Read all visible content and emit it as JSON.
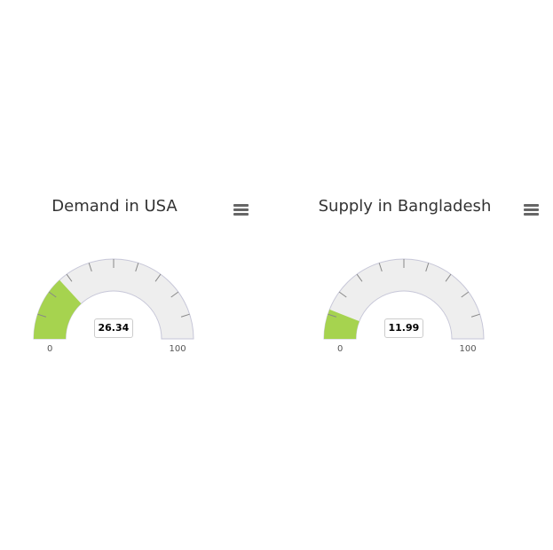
{
  "chart_data": [
    {
      "type": "gauge",
      "title": "Demand in USA",
      "value": 26.34,
      "value_label": "26.34",
      "min": 0,
      "max": 100,
      "min_label": "0",
      "max_label": "100",
      "fill_color": "#a6d34f",
      "track_color": "#eeeeee"
    },
    {
      "type": "gauge",
      "title": "Supply in Bangladesh",
      "value": 11.99,
      "value_label": "11.99",
      "min": 0,
      "max": 100,
      "min_label": "0",
      "max_label": "100",
      "fill_color": "#a6d34f",
      "track_color": "#eeeeee"
    }
  ],
  "icons": {
    "menu": "hamburger-menu-icon"
  }
}
